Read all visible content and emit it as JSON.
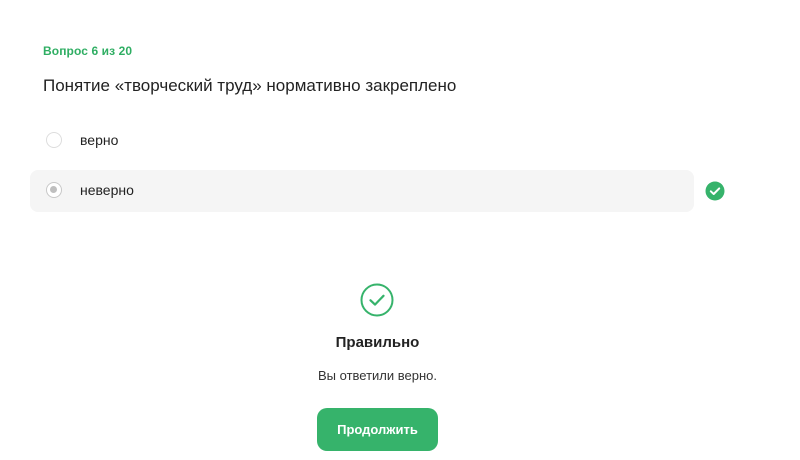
{
  "colors": {
    "accent": "#36b36b",
    "counter_text": "#2fae63",
    "selected_row_bg": "#f5f5f5"
  },
  "quiz": {
    "counter": "Вопрос 6 из 20",
    "question": "Понятие «творческий труд» нормативно закреплено",
    "options": [
      {
        "label": "верно",
        "selected": false,
        "correct": false
      },
      {
        "label": "неверно",
        "selected": true,
        "correct": true
      }
    ]
  },
  "result": {
    "icon": "check-circle-outline-icon",
    "title": "Правильно",
    "message": "Вы ответили верно.",
    "continue_label": "Продолжить"
  }
}
